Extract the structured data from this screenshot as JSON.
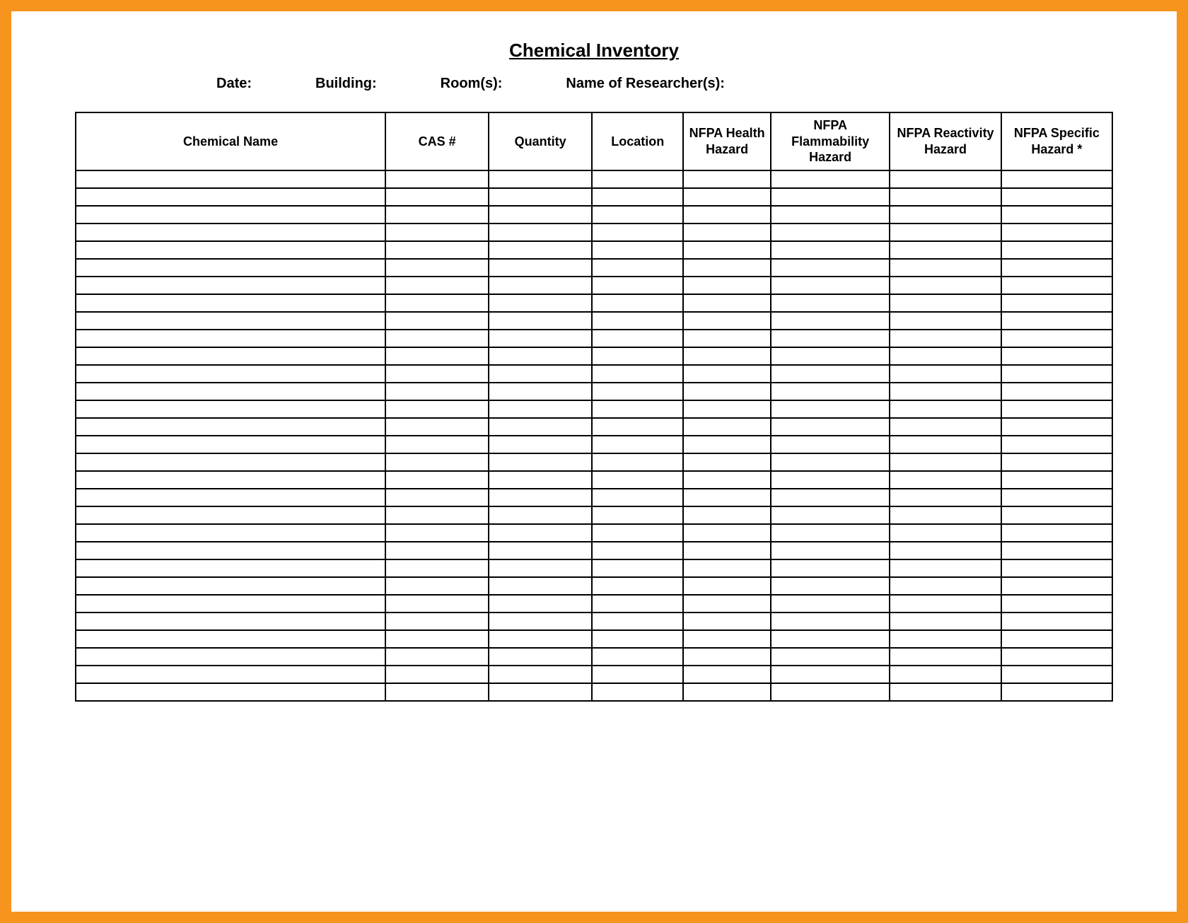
{
  "title": "Chemical Inventory",
  "meta": {
    "date_label": "Date:",
    "building_label": "Building:",
    "rooms_label": "Room(s):",
    "researchers_label": "Name of Researcher(s):"
  },
  "columns": {
    "chemical_name": "Chemical Name",
    "cas": "CAS #",
    "quantity": "Quantity",
    "location": "Location",
    "nfpa_health": "NFPA Health Hazard",
    "nfpa_flammability": "NFPA Flammability Hazard",
    "nfpa_reactivity": "NFPA Reactivity Hazard",
    "nfpa_specific": "NFPA Specific Hazard *"
  },
  "row_count": 30
}
